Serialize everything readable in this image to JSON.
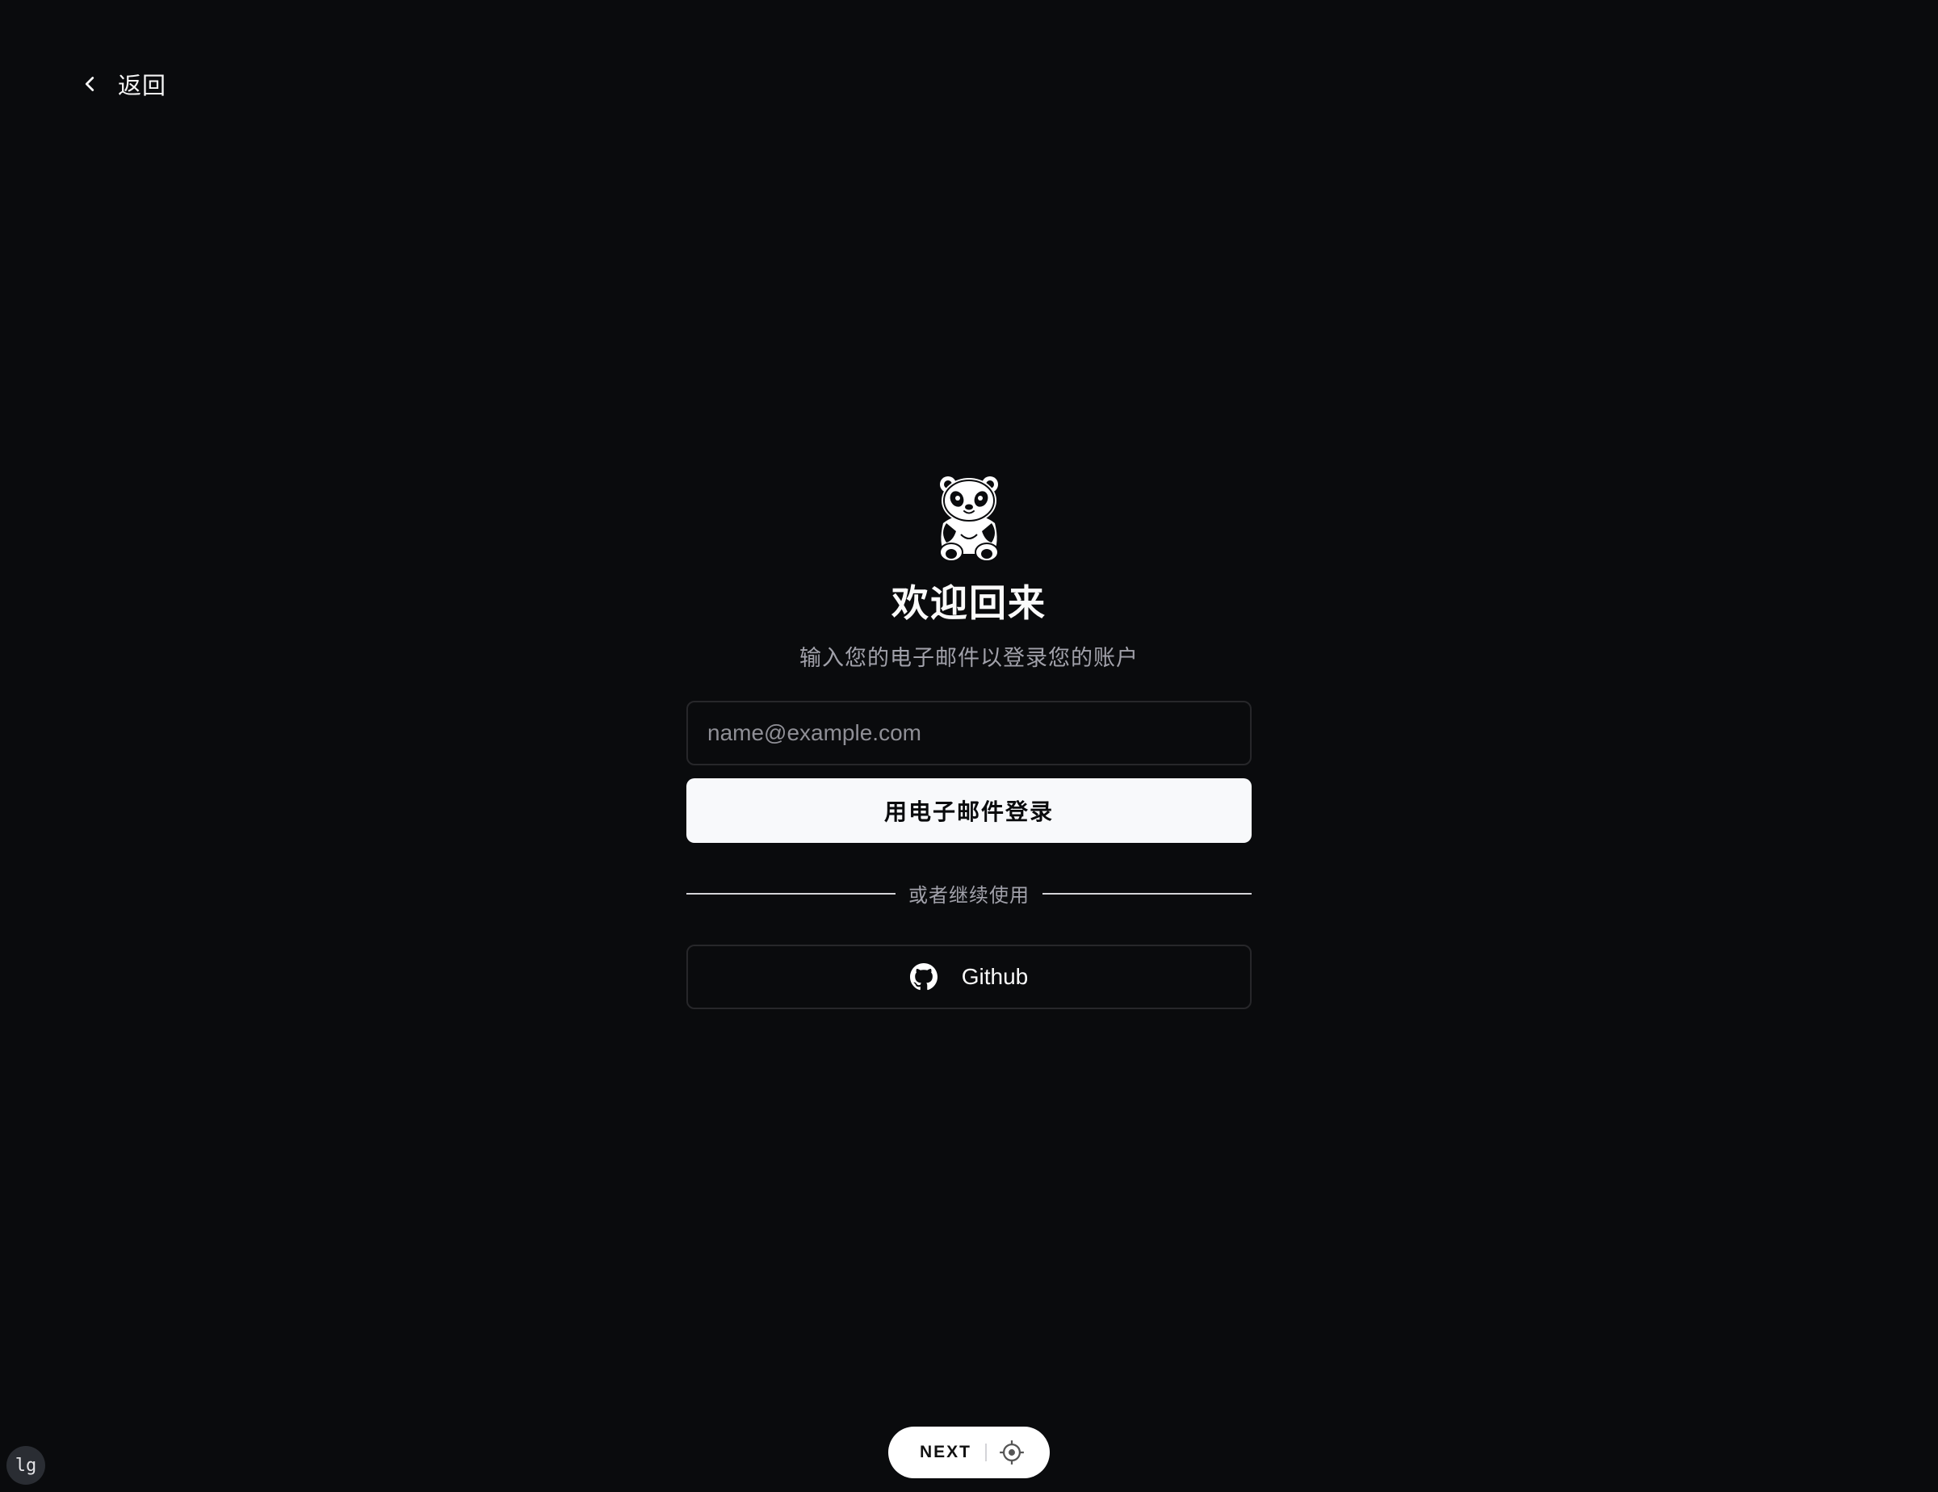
{
  "back": {
    "label": "返回",
    "icon": "chevron-left-icon"
  },
  "auth": {
    "logo": "panda-logo-icon",
    "title": "欢迎回来",
    "subtitle": "输入您的电子邮件以登录您的账户",
    "email": {
      "placeholder": "name@example.com",
      "value": ""
    },
    "submit_label": "用电子邮件登录",
    "divider_text": "或者继续使用",
    "github_label": "Github"
  },
  "dev_toolbar": {
    "brand": "NEXT",
    "icon": "crosshair-icon"
  },
  "breakpoint_badge": "lg",
  "colors": {
    "background": "#0a0b0d",
    "primary_button": "#f8f9fb",
    "border": "#27272a",
    "muted_text": "#a1a1aa"
  }
}
